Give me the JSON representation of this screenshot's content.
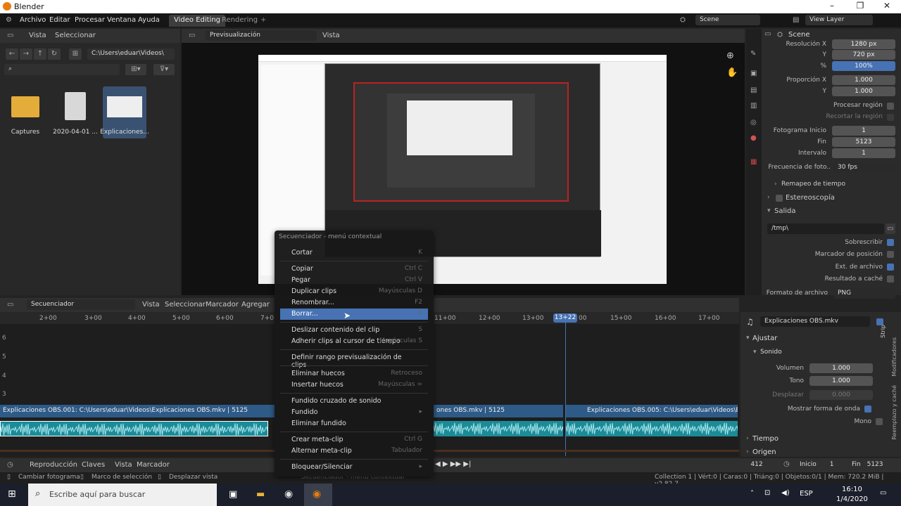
{
  "window": {
    "title": "Blender"
  },
  "menubar": {
    "items": [
      "Archivo",
      "Editar",
      "Procesar",
      "Ventana",
      "Ayuda"
    ],
    "tabs": [
      "Video Editing",
      "Rendering"
    ],
    "add_tab": "+",
    "scene": "Scene",
    "view_layer": "View Layer"
  },
  "filebrowser": {
    "header_items": [
      "Vista",
      "Seleccionar"
    ],
    "path": "C:\\Users\\eduar\\Videos\\",
    "files": [
      {
        "name": "Captures",
        "kind": "folder"
      },
      {
        "name": "2020-04-01 ...",
        "kind": "file"
      },
      {
        "name": "Explicaciones...",
        "kind": "video",
        "selected": true
      }
    ]
  },
  "preview": {
    "mode": "Previsualización",
    "view": "Vista"
  },
  "properties": {
    "scene": "Scene",
    "rows": [
      {
        "label": "Resolución X",
        "value": "1280 px"
      },
      {
        "label": "Y",
        "value": "720 px"
      },
      {
        "label": "%",
        "value": "100%"
      },
      {
        "label": "Proporción X",
        "value": "1.000"
      },
      {
        "label": "Y",
        "value": "1.000"
      }
    ],
    "process_region": "Procesar región",
    "crop_region": "Recortar la región",
    "frames": [
      {
        "label": "Fotograma  Inicio",
        "value": "1"
      },
      {
        "label": "Fin",
        "value": "5123"
      },
      {
        "label": "Intervalo",
        "value": "1"
      }
    ],
    "fps_label": "Frecuencia de foto..",
    "fps": "30 fps",
    "time_remap": "Remapeo de tiempo",
    "stereo": "Estereoscopía",
    "output": "Salida",
    "output_path": "/tmp\\",
    "checks": [
      {
        "label": "Sobrescribir",
        "on": true
      },
      {
        "label": "Marcador de posición",
        "on": false
      },
      {
        "label": "Ext. de archivo",
        "on": true
      },
      {
        "label": "Resultado a caché",
        "on": false
      }
    ],
    "format_label": "Formato de archivo",
    "format": "PNG"
  },
  "sequencer": {
    "header": [
      "Secuenciador",
      "Vista",
      "Seleccionar",
      "Marcador",
      "Agregar"
    ],
    "ticks": [
      "2+00",
      "3+00",
      "4+00",
      "5+00",
      "6+00",
      "7+0",
      "11+00",
      "12+00",
      "13+00",
      "13+22",
      "00",
      "15+00",
      "16+00",
      "17+00"
    ],
    "channels": [
      "6",
      "5",
      "4",
      "3"
    ],
    "strips": [
      "Explicaciones OBS.001: C:\\Users\\eduar\\Videos\\Explicaciones OBS.mkv | 5125",
      "ones OBS.mkv | 5125",
      "Explicaciones OBS.005: C:\\Users\\eduar\\Videos\\Expli"
    ]
  },
  "strip_props": {
    "name": "Explicaciones OBS.mkv",
    "adjust": "Ajustar",
    "sound": "Sonido",
    "volume_label": "Volumen",
    "volume": "1.000",
    "pitch_label": "Tono",
    "pitch": "1.000",
    "pan_label": "Desplazar",
    "pan": "0.000",
    "waveform": "Mostrar forma de onda",
    "mono": "Mono",
    "time": "Tiempo",
    "origin": "Origen",
    "tabs": [
      "Strip",
      "Modificadores",
      "Reemplazo y caché"
    ]
  },
  "timeline": {
    "items": [
      "Reproducción",
      "Claves",
      "Vista",
      "Marcador"
    ],
    "frame": "412",
    "start_label": "Inicio",
    "start": "1",
    "end_label": "Fin",
    "end": "5123"
  },
  "status": {
    "left": [
      "Cambiar fotograma",
      "Marco de selección",
      "Desplazar vista"
    ],
    "middle": "Secuenciador - menú contextual",
    "right": "Collection 1 | Vért:0 | Caras:0 | Triáng:0 | Objetos:0/1 | Mem: 720.2 MiB | v2.82.7"
  },
  "taskbar": {
    "search": "Escribe aquí para buscar",
    "lang": "ESP",
    "time": "16:10",
    "date": "1/4/2020"
  },
  "context_menu": {
    "title": "Secuenciador - menú contextual",
    "items": [
      {
        "label": "Cortar",
        "shortcut": "K"
      },
      {
        "sep": true
      },
      {
        "label": "Copiar",
        "shortcut": "Ctrl C"
      },
      {
        "label": "Pegar",
        "shortcut": "Ctrl V"
      },
      {
        "label": "Duplicar clips",
        "shortcut": "Mayúsculas D"
      },
      {
        "label": "Renombrar...",
        "shortcut": "F2"
      },
      {
        "label": "Borrar...",
        "shortcut": "X",
        "highlight": true
      },
      {
        "sep": true
      },
      {
        "label": "Deslizar contenido del clip",
        "shortcut": "S"
      },
      {
        "label": "Adherir clips al cursor de tiempo",
        "shortcut": "Mayúsculas S"
      },
      {
        "sep": true
      },
      {
        "label": "Definir rango previsualización de clips",
        "shortcut": ""
      },
      {
        "sep": true
      },
      {
        "label": "Eliminar huecos",
        "shortcut": "Retroceso"
      },
      {
        "label": "Insertar huecos",
        "shortcut": "Mayúsculas ="
      },
      {
        "sep": true
      },
      {
        "label": "Fundido cruzado de sonido",
        "shortcut": ""
      },
      {
        "label": "Fundido",
        "shortcut": "▸"
      },
      {
        "label": "Eliminar fundido",
        "shortcut": ""
      },
      {
        "sep": true
      },
      {
        "label": "Crear meta-clip",
        "shortcut": "Ctrl G"
      },
      {
        "label": "Alternar meta-clip",
        "shortcut": "Tabulador"
      },
      {
        "sep": true
      },
      {
        "label": "Bloquear/Silenciar",
        "shortcut": "▸"
      }
    ]
  },
  "colors": {
    "accent": "#4772b3",
    "strip_audio": "#1c8b98",
    "strip_movie": "#2e5a87"
  }
}
